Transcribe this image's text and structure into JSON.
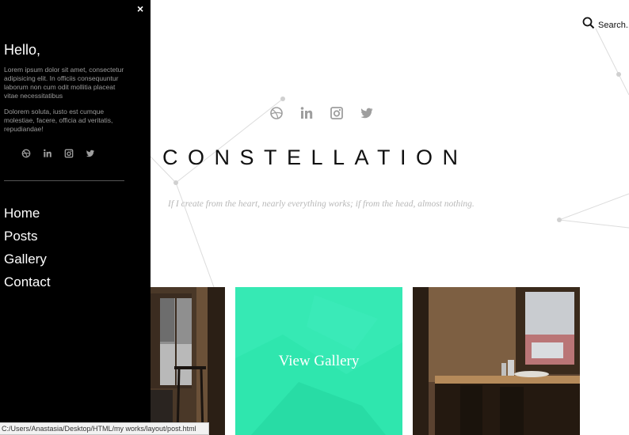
{
  "sidebar": {
    "close_label": "×",
    "greeting": "Hello,",
    "paragraph_1": "Lorem ipsum dolor sit amet, consectetur adipisicing elit. In officiis consequuntur laborum non cum odit mollitia placeat vitae necessitatibus",
    "paragraph_2": "Dolorem soluta, iusto est cumque molestiae, facere, officia ad veritatis, repudiandae!",
    "social_icons": [
      "dribbble-icon",
      "linkedin-icon",
      "instagram-icon",
      "twitter-icon"
    ],
    "nav": [
      {
        "label": "Home"
      },
      {
        "label": "Posts"
      },
      {
        "label": "Gallery"
      },
      {
        "label": "Contact"
      }
    ]
  },
  "search": {
    "label": "Search.."
  },
  "hero": {
    "title": "CONSTELLATION",
    "tagline": "If I create from the heart, nearly everything works; if from the head, almost nothing.",
    "social_icons": [
      "dribbble-icon",
      "linkedin-icon",
      "instagram-icon",
      "twitter-icon"
    ]
  },
  "tiles": {
    "gallery_label": "View Gallery"
  },
  "status_bar": {
    "url": "C:/Users/Anastasia/Desktop/HTML/my works/layout/post.html"
  },
  "colors": {
    "sidebar_bg": "#000000",
    "accent": "#2fe6ae",
    "icon_gray": "#9e9e9e"
  }
}
